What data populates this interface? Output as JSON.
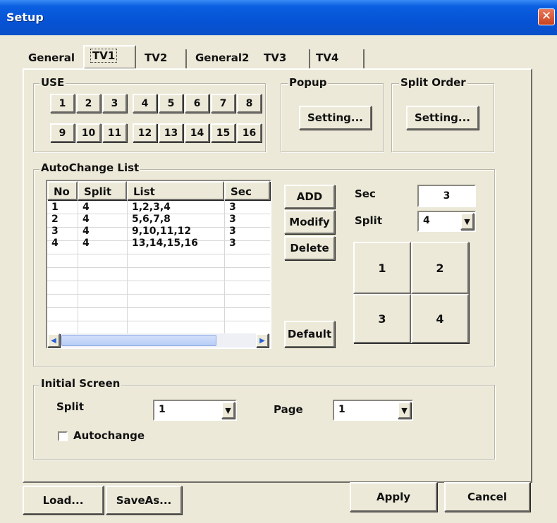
{
  "window": {
    "title": "Setup"
  },
  "tabs": [
    {
      "label": "General"
    },
    {
      "label": "TV1"
    },
    {
      "label": "TV2"
    },
    {
      "label": "General2"
    },
    {
      "label": "TV3"
    },
    {
      "label": "TV4"
    }
  ],
  "use": {
    "legend": "USE",
    "row1": [
      "1",
      "2",
      "3",
      "4",
      "5",
      "6",
      "7",
      "8"
    ],
    "row2": [
      "9",
      "10",
      "11",
      "12",
      "13",
      "14",
      "15",
      "16"
    ]
  },
  "popup": {
    "legend": "Popup",
    "button": "Setting..."
  },
  "split_order": {
    "legend": "Split Order",
    "button": "Setting..."
  },
  "autochange": {
    "legend": "AutoChange List",
    "columns": [
      "No",
      "Split",
      "List",
      "Sec"
    ],
    "rows": [
      [
        "1",
        "4",
        "1,2,3,4",
        "3"
      ],
      [
        "2",
        "4",
        "5,6,7,8",
        "3"
      ],
      [
        "3",
        "4",
        "9,10,11,12",
        "3"
      ],
      [
        "4",
        "4",
        "13,14,15,16",
        "3"
      ]
    ],
    "buttons": {
      "add": "ADD",
      "modify": "Modify",
      "delete": "Delete",
      "default": "Default"
    },
    "sec_label": "Sec",
    "sec_value": "3",
    "split_label": "Split",
    "split_value": "4",
    "grid": [
      "1",
      "2",
      "3",
      "4"
    ]
  },
  "initial_screen": {
    "legend": "Initial Screen",
    "split_label": "Split",
    "split_value": "1",
    "page_label": "Page",
    "page_value": "1",
    "autochange_label": "Autochange",
    "autochange_checked": false
  },
  "footer": {
    "load": "Load...",
    "saveas": "SaveAs...",
    "apply": "Apply",
    "cancel": "Cancel"
  }
}
